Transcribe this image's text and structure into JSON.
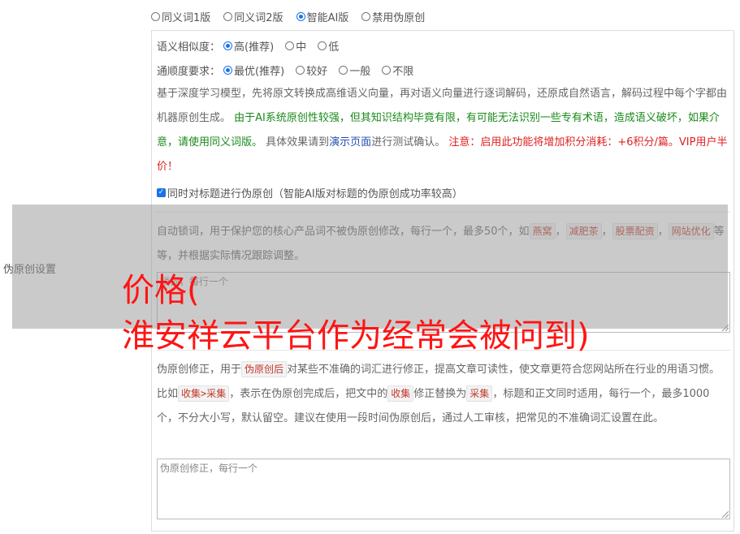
{
  "modes": [
    {
      "label": "同义词1版",
      "selected": false
    },
    {
      "label": "同义词2版",
      "selected": false
    },
    {
      "label": "智能AI版",
      "selected": true
    },
    {
      "label": "禁用伪原创",
      "selected": false
    }
  ],
  "similarity": {
    "label": "语义相似度：",
    "options": [
      {
        "label": "高(推荐)",
        "selected": true
      },
      {
        "label": "中",
        "selected": false
      },
      {
        "label": "低",
        "selected": false
      }
    ]
  },
  "fluency": {
    "label": "通顺度要求：",
    "options": [
      {
        "label": "最优(推荐)",
        "selected": true
      },
      {
        "label": "较好",
        "selected": false
      },
      {
        "label": "一般",
        "selected": false
      },
      {
        "label": "不限",
        "selected": false
      }
    ]
  },
  "description": {
    "part1": "基于深度学习模型，先将原文转换成高维语义向量，再对语义向量进行逐词解码，还原成自然语言，解码过程中每个字都由机器原创生成。",
    "part2": "由于AI系统原创性较强，但其知识结构毕竟有限，有可能无法识别一些专有术语，造成语义破坏，如果介意，请使用同义词版。",
    "part3": "具体效果请到",
    "link": "演示页面",
    "part4": "进行测试确认。",
    "part5": "注意：启用此功能将增加积分消耗：+6积分/篇。VIP用户半价！"
  },
  "title_checkbox": {
    "checked": true,
    "label": "同时对标题进行伪原创（智能AI版对标题的伪原创成功率较高）"
  },
  "lock_words": {
    "text1": "自动锁词，用于保护您的核心产品词不被伪原创修改，每行一个，最多50个，如",
    "tags": [
      "燕窝",
      "减肥茶",
      "股票配资",
      "网站优化"
    ],
    "sep": "，",
    "text2": "等等，并根据实际情况跟踪调整。",
    "placeholder_prefix": "锁词",
    "placeholder": "每行一个"
  },
  "correction": {
    "text1": "伪原创修正，用于",
    "tag1": "伪原创后",
    "text2": "对某些不准确的词汇进行修正，提高文章可读性，使文章更符合您网站所在行业的用语习惯。比如",
    "tag2": "收集>采集",
    "text3": "，表示在伪原创完成后，把文中的",
    "tag3": "收集",
    "text4": "修正替换为",
    "tag4": "采集",
    "text5": "，标题和正文同时适用，每行一个，最多1000个，不分大小写，默认留空。建议在使用一段时间伪原创后，通过人工审核，把常见的不准确词汇设置在此。",
    "placeholder": "伪原创修正，每行一个"
  },
  "left_label": "伪原创设置",
  "overlay_line1": "价格(",
  "overlay_line2": "淮安祥云平台作为经常会被问到)",
  "colors": {
    "accent": "#1a73e8",
    "green": "#1a8a1a",
    "red": "#e02020",
    "overlay_text": "#ff1414"
  }
}
